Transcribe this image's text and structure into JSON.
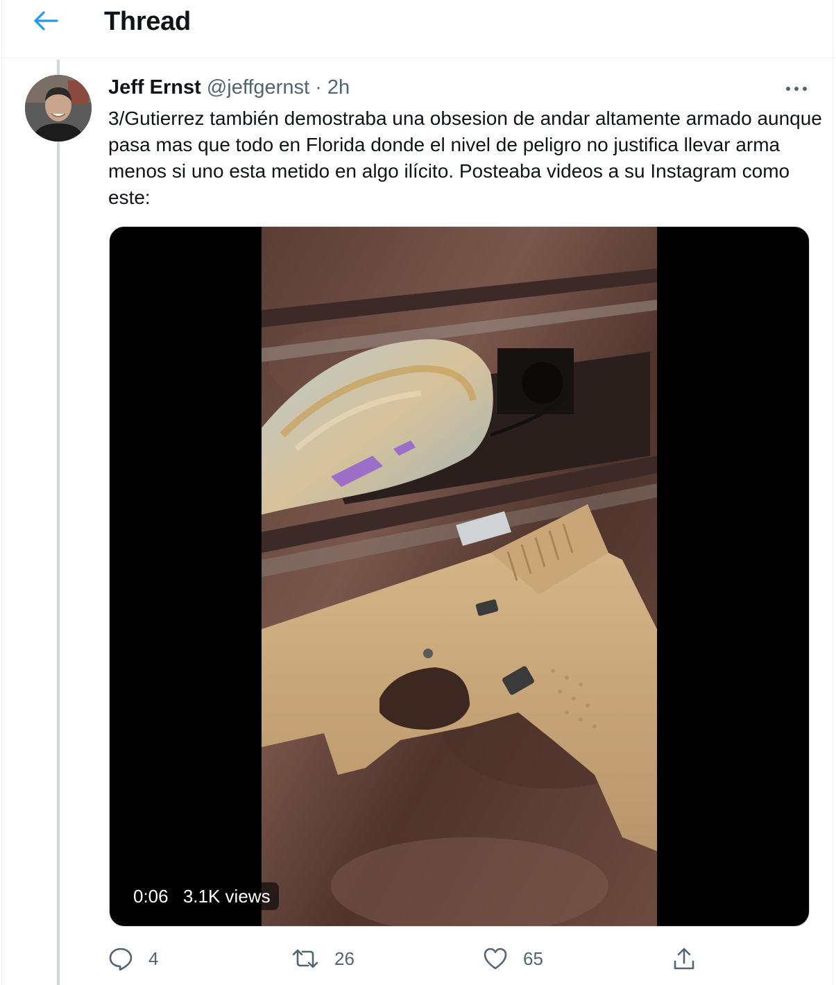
{
  "header": {
    "title": "Thread"
  },
  "tweet": {
    "author_name": "Jeff Ernst",
    "author_handle": "@jeffgernst",
    "separator": "·",
    "time": "2h",
    "text": "3/Gutierrez también demostraba una obsesion de andar altamente armado aunque pasa mas que todo en Florida donde el nivel de peligro no justifica llevar arma menos si uno esta metido en algo ilícito. Posteaba videos a su Instagram como este:",
    "video": {
      "duration": "0:06",
      "views": "3.1K views"
    },
    "actions": {
      "reply_count": "4",
      "retweet_count": "26",
      "like_count": "65"
    }
  },
  "icons": {
    "back": "back-arrow-icon",
    "more": "more-dots-icon",
    "reply": "reply-bubble-icon",
    "retweet": "retweet-icon",
    "like": "heart-icon",
    "share": "share-icon"
  },
  "colors": {
    "accent": "#1d9bf0",
    "text": "#0f1419",
    "secondary": "#536471",
    "thread_line": "#cfd9de"
  }
}
